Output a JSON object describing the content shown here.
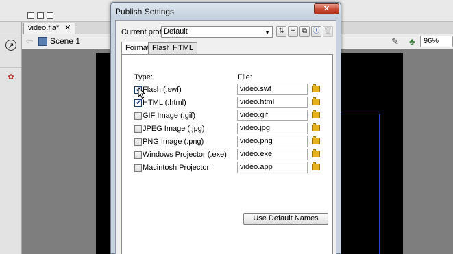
{
  "app": {
    "doc_tab_label": "video.fla*",
    "doc_tab_close": "✕",
    "scene_label": "Scene 1",
    "zoom_value": "96%"
  },
  "dialog": {
    "title": "Publish Settings",
    "close_glyph": "✕",
    "profile_label": "Current profile:",
    "profile_value": "Default",
    "toolbar_icons": [
      "import-export-icon",
      "add-profile-icon",
      "duplicate-profile-icon",
      "profile-info-icon",
      "delete-profile-icon"
    ],
    "tabs": [
      {
        "label": "Formats",
        "active": true
      },
      {
        "label": "Flash",
        "active": false
      },
      {
        "label": "HTML",
        "active": false
      }
    ],
    "type_header": "Type:",
    "file_header": "File:",
    "formats": [
      {
        "label": "Flash  (.swf)",
        "checked": true,
        "file": "video.swf"
      },
      {
        "label": "HTML (.html)",
        "checked": true,
        "file": "video.html"
      },
      {
        "label": "GIF Image (.gif)",
        "checked": false,
        "file": "video.gif"
      },
      {
        "label": "JPEG Image (.jpg)",
        "checked": false,
        "file": "video.jpg"
      },
      {
        "label": "PNG Image (.png)",
        "checked": false,
        "file": "video.png"
      },
      {
        "label": "Windows Projector (.exe)",
        "checked": false,
        "file": "video.exe"
      },
      {
        "label": "Macintosh Projector",
        "checked": false,
        "file": "video.app"
      }
    ],
    "use_default_label": "Use Default Names"
  },
  "colors": {
    "close_red": "#c7472f",
    "folder_yellow": "#e6b21e",
    "stage_black": "#000000"
  }
}
